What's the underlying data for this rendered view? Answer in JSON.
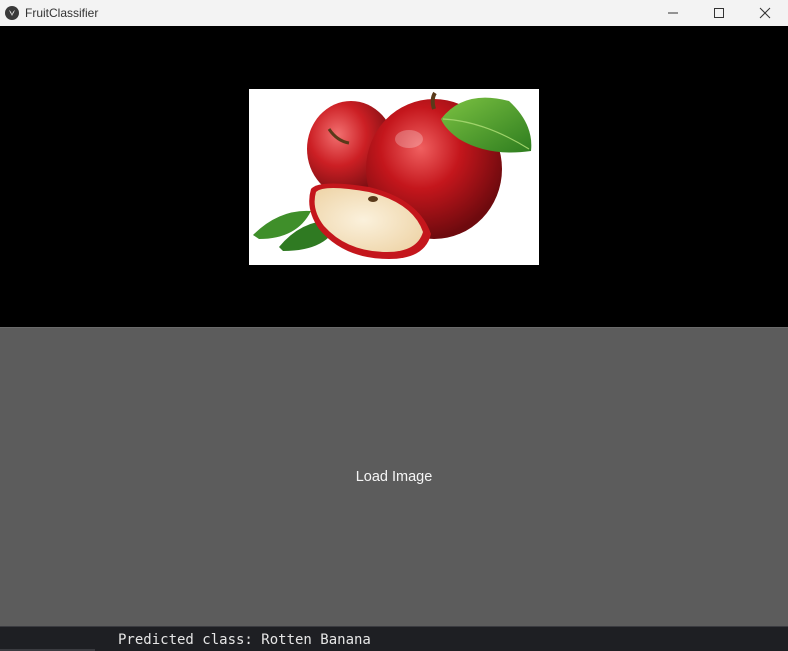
{
  "window": {
    "title": "FruitClassifier"
  },
  "icons": {
    "app": "kivy-logo-icon",
    "minimize": "minimize-icon",
    "maximize": "maximize-icon",
    "close": "close-icon"
  },
  "main": {
    "image": "apple-photo",
    "load_button_label": "Load Image"
  },
  "console": {
    "output": "Predicted class: Rotten Banana"
  },
  "colors": {
    "button_bg": "#5c5c5c",
    "image_bg": "#000000",
    "titlebar_bg": "#f3f3f3",
    "console_bg": "#1e1f23"
  }
}
